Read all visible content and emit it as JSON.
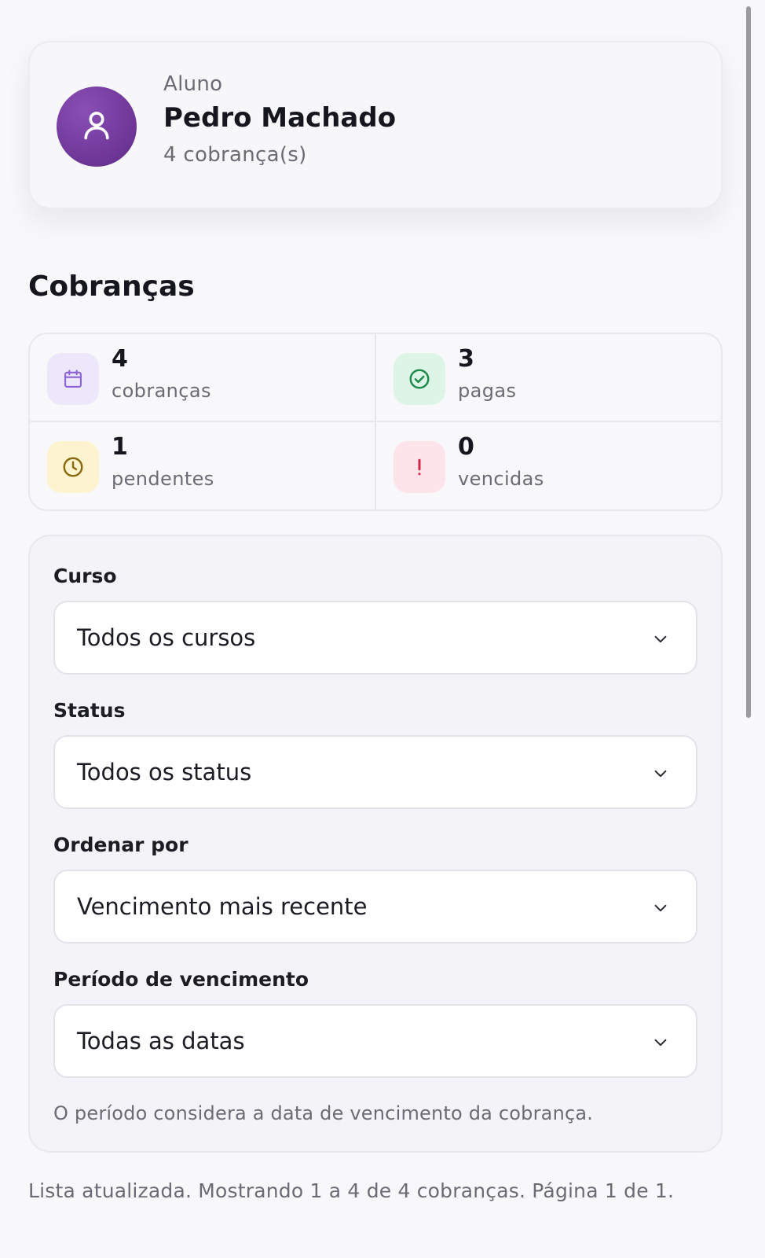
{
  "profile": {
    "role_label": "Aluno",
    "name": "Pedro Machado",
    "charges_count": "4 cobrança(s)",
    "avatar_icon": "user-icon",
    "avatar_color": "#6d3596"
  },
  "section_title": "Cobranças",
  "stats": [
    {
      "value": "4",
      "label": "cobranças",
      "icon": "calendar-icon",
      "bg": "#ece7fb",
      "color": "#8d62d8"
    },
    {
      "value": "3",
      "label": "pagas",
      "icon": "check-circle-icon",
      "bg": "#ddf5e6",
      "color": "#1f8a4c"
    },
    {
      "value": "1",
      "label": "pendentes",
      "icon": "clock-icon",
      "bg": "#fdf3cf",
      "color": "#8a6a10"
    },
    {
      "value": "0",
      "label": "vencidas",
      "icon": "alert-icon",
      "bg": "#fde4ea",
      "color": "#d12a4a"
    }
  ],
  "filters": {
    "course": {
      "label": "Curso",
      "value": "Todos os cursos"
    },
    "status": {
      "label": "Status",
      "value": "Todos os status"
    },
    "sort": {
      "label": "Ordenar por",
      "value": "Vencimento mais recente"
    },
    "period": {
      "label": "Período de vencimento",
      "value": "Todas as datas"
    },
    "hint": "O período considera a data de vencimento da cobrança."
  },
  "status_line": "Lista atualizada. Mostrando 1 a 4 de 4 cobranças. Página 1 de 1."
}
